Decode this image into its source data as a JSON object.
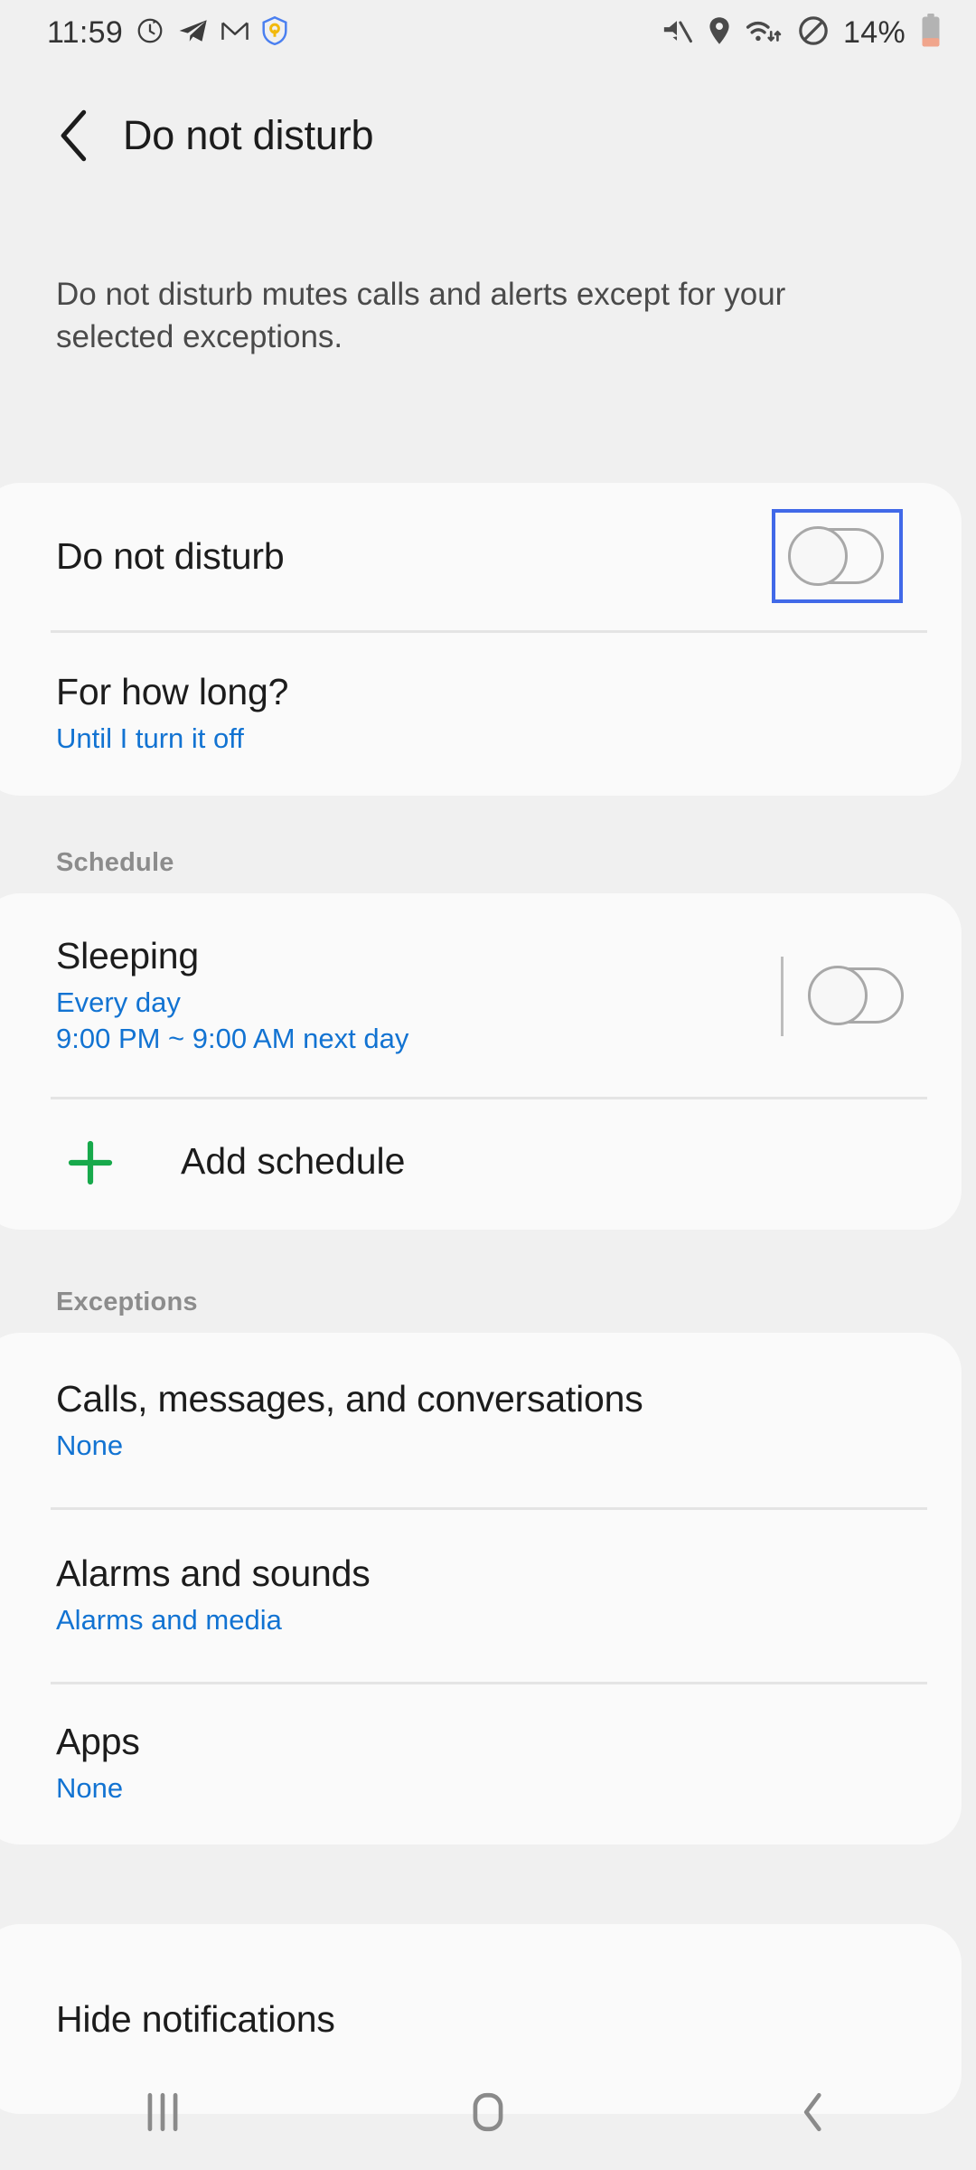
{
  "status_bar": {
    "clock": "11:59",
    "battery_percent": "14%",
    "left_icons": [
      "clock-alarm-icon",
      "telegram-icon",
      "gmail-icon",
      "authenticator-icon"
    ],
    "right_icons": [
      "mute-icon",
      "location-icon",
      "wifi-icon",
      "do-not-disturb-icon",
      "battery-icon"
    ]
  },
  "header": {
    "title": "Do not disturb",
    "back_icon": "back-chevron-icon"
  },
  "description": "Do not disturb mutes calls and alerts except for your selected exceptions.",
  "main_card": {
    "dnd": {
      "title": "Do not disturb",
      "toggle_state": "off",
      "focused": true
    },
    "duration": {
      "title": "For how long?",
      "value": "Until I turn it off"
    }
  },
  "schedule": {
    "header": "Schedule",
    "items": [
      {
        "title": "Sleeping",
        "sub1": "Every day",
        "sub2": "9:00 PM ~ 9:00 AM next day",
        "toggle_state": "off"
      }
    ],
    "add": {
      "label": "Add schedule",
      "icon": "plus-icon"
    }
  },
  "exceptions": {
    "header": "Exceptions",
    "items": [
      {
        "title": "Calls, messages, and conversations",
        "value": "None"
      },
      {
        "title": "Alarms and sounds",
        "value": "Alarms and media"
      },
      {
        "title": "Apps",
        "value": "None"
      }
    ]
  },
  "hide_notifications": {
    "title": "Hide notifications"
  },
  "nav_bar": {
    "recents_icon": "recents-icon",
    "home_icon": "home-icon",
    "back_icon": "back-icon"
  },
  "colors": {
    "page_bg": "#f0f0f0",
    "card_bg": "#fafafa",
    "accent_blue": "#1273d2",
    "focus_blue": "#4169e8",
    "accent_green": "#17a94b",
    "title_text": "#1c1c1c",
    "section_text": "#8c8c8c"
  }
}
